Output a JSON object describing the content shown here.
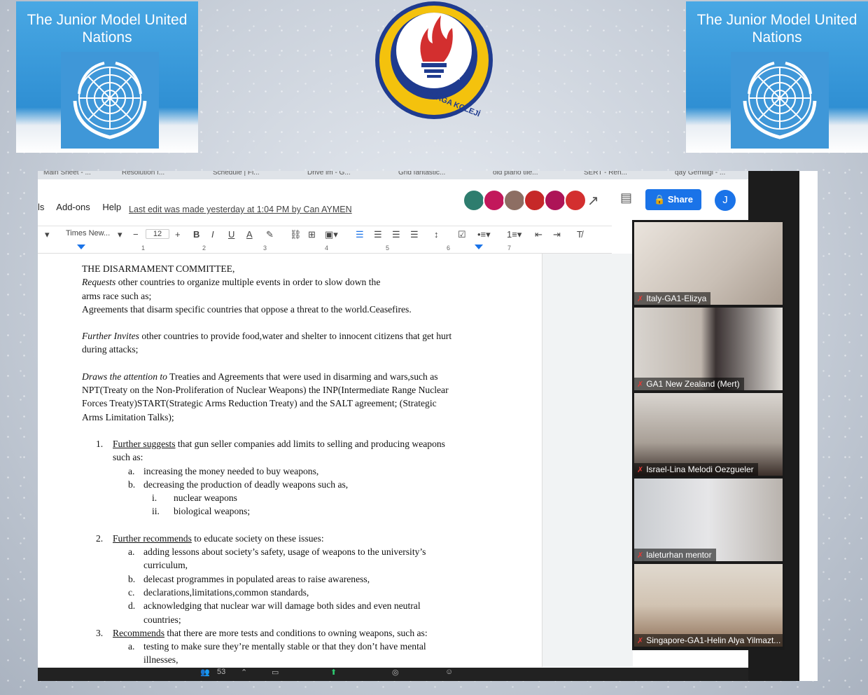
{
  "banner": {
    "left_title": "The Junior Model United Nations",
    "right_title": "The Junior Model United Nations"
  },
  "seal": {
    "text": "TED ALİAĞA KOLEJİ"
  },
  "browser_tabs": [
    "Main Sheet - ...",
    "Resolution f...",
    "Schedule | Fi...",
    "Drive im - G...",
    "Grid fantastic...",
    "old piano tile...",
    "SERT - Ren...",
    "qay Gemiligi - ..."
  ],
  "docs": {
    "menu": [
      "ls",
      "Add-ons",
      "Help"
    ],
    "last_edit": "Last edit was made yesterday at 1:04 PM by Can AYMEN",
    "share_label": "Share",
    "user_initial": "J",
    "font_name": "Times New...",
    "font_size": "12",
    "ruler_numbers": [
      "1",
      "2",
      "3",
      "4",
      "5",
      "6",
      "7"
    ]
  },
  "document": {
    "heading": "THE DISARMAMENT COMMITTEE,",
    "p1_em": "Requests",
    "p1_rest": " other countries to organize multiple events in order to slow down the",
    "p1_line2": "arms race such as;",
    "p1_line3": "Agreements  that disarm specific countries that oppose a threat to the world.Ceasefires.",
    "p2_em": "Further Invites",
    "p2_rest": " other countries to provide food,water and shelter to innocent citizens that get hurt",
    "p2_line2": "during attacks;",
    "p3_em": "Draws the attention to",
    "p3_rest": " Treaties and Agreements that were used in disarming and wars,such as",
    "p3_line2": "NPT(Treaty on the Non-Proliferation of Nuclear Weapons) the INP(Intermediate Range Nuclear",
    "p3_line3": "Forces Treaty)START(Strategic Arms Reduction Treaty) and the SALT agreement; (Strategic",
    "p3_line4": "Arms Limitation Talks);",
    "item1_num": "1.",
    "item1_u": "Further suggests",
    "item1_rest": "  that gun seller companies add limits to selling and producing weapons",
    "item1_line2": "such as:",
    "item1a_num": "a.",
    "item1a": "increasing the money needed to buy weapons,",
    "item1b_num": "b.",
    "item1b": "decreasing the production of  deadly weapons such as,",
    "item1bi_num": "i.",
    "item1bi": "nuclear weapons",
    "item1bii_num": "ii.",
    "item1bii": "biological weapons;",
    "item2_num": "2.",
    "item2_u": "Further recommends",
    "item2_rest": " to educate society on these issues:",
    "item2a_num": "a.",
    "item2a": "adding lessons about society’s safety, usage of weapons to the university’s",
    "item2a_line2": "curriculum,",
    "item2b_num": "b.",
    "item2b": "delecast programmes in populated areas to raise awareness,",
    "item2c_num": "c.",
    "item2c": "declarations,limitations,common standards,",
    "item2d_num": "d.",
    "item2d": "acknowledging that nuclear war will damage both sides and even neutral",
    "item2d_line2": "countries;",
    "item3_num": "3.",
    "item3_u": "Recommends",
    "item3_rest": " that there are more tests and conditions to owning weapons, such as:",
    "item3a_num": "a.",
    "item3a": "testing to make sure they’re mentally stable or that they don’t have mental",
    "item3a_line2": "illnesses,"
  },
  "participants": [
    {
      "name": "Italy-GA1-Elizya"
    },
    {
      "name": "GA1 New Zealand (Mert)"
    },
    {
      "name": "Israel-Lina Melodi Oezgueler"
    },
    {
      "name": "laleturhan mentor"
    },
    {
      "name": "Singapore-GA1-Helin Alya Yilmazt..."
    }
  ],
  "zoom": {
    "participant_count": "53"
  },
  "colors": {
    "accent": "#1a73e8",
    "banner_blue": "#3a9be0",
    "seal_blue": "#1f3b8f",
    "seal_yellow": "#f4c20d",
    "flame_red": "#d32f2f"
  }
}
